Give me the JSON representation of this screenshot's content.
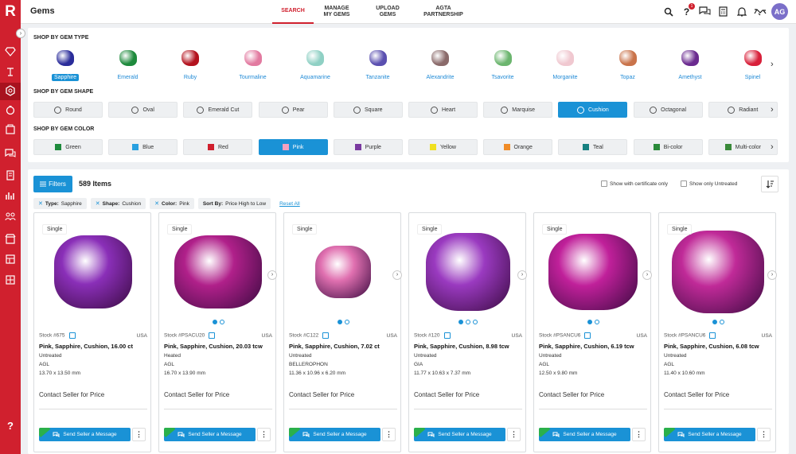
{
  "app": {
    "logo": "R",
    "title": "Gems"
  },
  "tabs": [
    {
      "label": "SEARCH",
      "active": true
    },
    {
      "label": "MANAGE MY GEMS",
      "active": false
    },
    {
      "label": "UPLOAD GEMS",
      "active": false
    },
    {
      "label": "AGTA PARTNERSHIP",
      "active": false
    }
  ],
  "header": {
    "notification_count": "1",
    "avatar_initials": "AG"
  },
  "sidebar": {
    "help": "?"
  },
  "shop": {
    "type_title": "SHOP BY GEM TYPE",
    "shape_title": "SHOP BY GEM SHAPE",
    "color_title": "SHOP BY GEM COLOR",
    "types": [
      {
        "label": "Sapphire",
        "color": "#2a2c9a",
        "selected": true
      },
      {
        "label": "Emerald",
        "color": "#1e8a3c"
      },
      {
        "label": "Ruby",
        "color": "#b3121e"
      },
      {
        "label": "Tourmaline",
        "color": "#e27aa0"
      },
      {
        "label": "Aquamarine",
        "color": "#8fd0c4"
      },
      {
        "label": "Tanzanite",
        "color": "#5a4fb0"
      },
      {
        "label": "Alexandrite",
        "color": "#8a6a6a"
      },
      {
        "label": "Tsavorite",
        "color": "#6bb56e"
      },
      {
        "label": "Morganite",
        "color": "#f0c8d0"
      },
      {
        "label": "Topaz",
        "color": "#c9734a"
      },
      {
        "label": "Amethyst",
        "color": "#6a2a8f"
      },
      {
        "label": "Spinel",
        "color": "#d8203a"
      }
    ],
    "shapes": [
      {
        "label": "Round"
      },
      {
        "label": "Oval"
      },
      {
        "label": "Emerald Cut"
      },
      {
        "label": "Pear"
      },
      {
        "label": "Square"
      },
      {
        "label": "Heart"
      },
      {
        "label": "Marquise"
      },
      {
        "label": "Cushion",
        "selected": true
      },
      {
        "label": "Octagonal"
      },
      {
        "label": "Radiant"
      }
    ],
    "colors": [
      {
        "label": "Green",
        "swatch": "#1e8a3c"
      },
      {
        "label": "Blue",
        "swatch": "#28a0e0"
      },
      {
        "label": "Red",
        "swatch": "#d0202e"
      },
      {
        "label": "Pink",
        "swatch": "#f4a0c0",
        "selected": true
      },
      {
        "label": "Purple",
        "swatch": "#7a3aa0"
      },
      {
        "label": "Yellow",
        "swatch": "#f0e020"
      },
      {
        "label": "Orange",
        "swatch": "#f08c28"
      },
      {
        "label": "Teal",
        "swatch": "#168080"
      },
      {
        "label": "Bi-color",
        "swatch": "#2a8a3a"
      },
      {
        "label": "Multi-color",
        "swatch": "#3a8a3a"
      }
    ]
  },
  "results": {
    "filters_label": "Filters",
    "count_label": "589 Items",
    "certificate_label": "Show with certificate only",
    "untreated_label": "Show only Untreated",
    "tags": [
      {
        "key": "Type:",
        "value": "Sapphire"
      },
      {
        "key": "Shape:",
        "value": "Cushion"
      },
      {
        "key": "Color:",
        "value": "Pink"
      }
    ],
    "sort_key": "Sort By:",
    "sort_value": "Price High to Low",
    "reset_label": "Reset All"
  },
  "cards": [
    {
      "badge": "Single",
      "stock": "Stock #675",
      "country": "USA",
      "title": "Pink, Sapphire, Cushion, 16.00 ct",
      "treatment": "Untreated",
      "lab": "AGL",
      "dims": "13.70 x 13.50 mm",
      "price": "Contact Seller for Price",
      "send": "Send Seller a Message",
      "color": "#8a2fb8",
      "dots": 0
    },
    {
      "badge": "Single",
      "stock": "Stock #PSACU20",
      "country": "USA",
      "title": "Pink, Sapphire, Cushion, 20.03 tcw",
      "treatment": "Heated",
      "lab": "AGL",
      "dims": "16.70 x 13.90 mm",
      "price": "Contact Seller for Price",
      "send": "Send Seller a Message",
      "color": "#b0208a",
      "dots": 2
    },
    {
      "badge": "Single",
      "stock": "Stock #C122",
      "country": "USA",
      "title": "Pink, Sapphire, Cushion, 7.02 ct",
      "treatment": "Untreated",
      "lab": "BELLEROPHON",
      "dims": "11.36 x 10.96 x 6.20 mm",
      "price": "Contact Seller for Price",
      "send": "Send Seller a Message",
      "color": "#e070b0",
      "dots": 2
    },
    {
      "badge": "Single",
      "stock": "Stock #120",
      "country": "USA",
      "title": "Pink, Sapphire, Cushion, 8.98 tcw",
      "treatment": "Untreated",
      "lab": "GIA",
      "dims": "11.77 x 10.63 x 7.37 mm",
      "price": "Contact Seller for Price",
      "send": "Send Seller a Message",
      "color": "#9a3ac0",
      "dots": 3
    },
    {
      "badge": "Single",
      "stock": "Stock #PSANCU6",
      "country": "USA",
      "title": "Pink, Sapphire, Cushion, 6.19 tcw",
      "treatment": "Untreated",
      "lab": "AGL",
      "dims": "12.50 x 9.80 mm",
      "price": "Contact Seller for Price",
      "send": "Send Seller a Message",
      "color": "#c0209a",
      "dots": 2
    },
    {
      "badge": "Single",
      "stock": "Stock #PSANCU6",
      "country": "USA",
      "title": "Pink, Sapphire, Cushion, 6.08 tcw",
      "treatment": "Untreated",
      "lab": "AGL",
      "dims": "11.40 x 10.60 mm",
      "price": "Contact Seller for Price",
      "send": "Send Seller a Message",
      "color": "#c02a98",
      "dots": 2
    }
  ]
}
